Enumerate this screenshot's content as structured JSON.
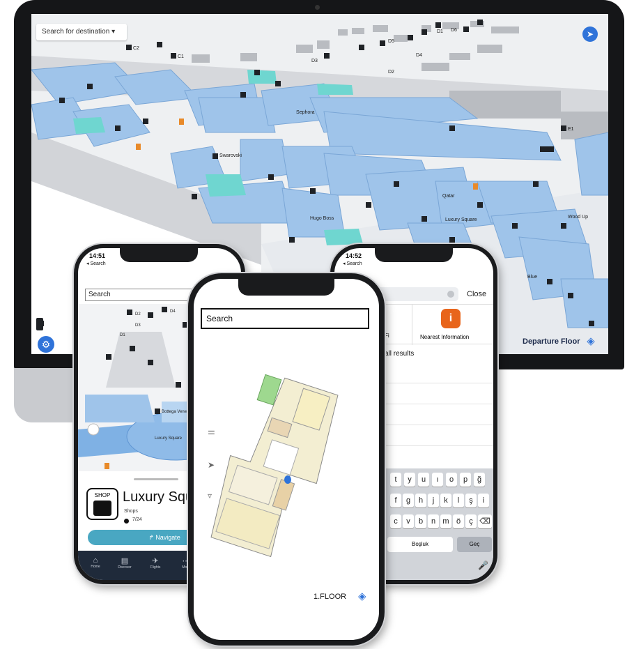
{
  "desktop": {
    "search_placeholder": "Search for destination",
    "floor_label": "Departure Floor",
    "map_labels": [
      "D1",
      "D2",
      "D3",
      "D4",
      "D5",
      "D6",
      "C1",
      "C2",
      "E1",
      "Luxury Square",
      "Wood Up",
      "Blue",
      "Swarovski",
      "Sephora",
      "Hugo Boss",
      "Qatar"
    ]
  },
  "phone_left": {
    "time": "14:51",
    "back_label": "◂ Search",
    "search_placeholder": "Search",
    "poi_badge": "SHOP",
    "poi_title": "Luxury Squ",
    "poi_category": "Shops",
    "poi_hours": "7/24",
    "navigate_label": "↱ Navigate",
    "tabs": [
      "Home",
      "Discover",
      "Flights",
      "More"
    ],
    "map_labels": [
      "D1",
      "D2",
      "D3",
      "D4",
      "Luxury Square",
      "Bottega Veneta"
    ]
  },
  "phone_center": {
    "search_placeholder": "Search",
    "floor_label": "1.FLOOR"
  },
  "phone_right": {
    "time": "14:52",
    "back_label": "◂ Search",
    "close_label": "Close",
    "tile_left": "Wi-Fi",
    "tile_right": "Nearest Information",
    "results_header": "all results",
    "keyboard_rows": [
      [
        "t",
        "y",
        "u",
        "ı",
        "o",
        "p",
        "ğ"
      ],
      [
        "f",
        "g",
        "h",
        "j",
        "k",
        "l",
        "ş",
        "i"
      ],
      [
        "c",
        "v",
        "b",
        "n",
        "m",
        "ö",
        "ç"
      ]
    ],
    "space_label": "Boşluk",
    "go_label": "Geç"
  },
  "colors": {
    "map_blue": "#9fc4ea",
    "map_teal": "#6fd6d0",
    "accent_blue": "#2f73d9",
    "navigate_teal": "#49a7c2",
    "info_orange": "#e8651b"
  }
}
